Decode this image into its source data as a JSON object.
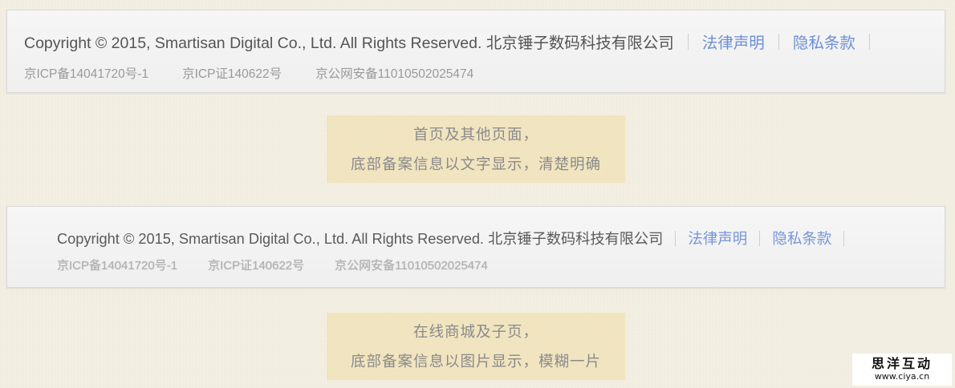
{
  "footer_new": {
    "copyright": "Copyright © 2015, Smartisan Digital Co., Ltd. All Rights Reserved. 北京锤子数码科技有限公司",
    "links": [
      "法律声明",
      "隐私条款"
    ],
    "icp": [
      "京ICP备14041720号-1",
      "京ICP证140622号",
      "京公网安备11010502025474"
    ]
  },
  "caption_1": {
    "line1": "首页及其他页面，",
    "line2": "底部备案信息以文字显示，清楚明确"
  },
  "footer_old": {
    "copyright": "Copyright © 2015, Smartisan Digital Co., Ltd. All Rights Reserved. 北京锤子数码科技有限公司",
    "links": [
      "法律声明",
      "隐私条款"
    ],
    "icp": [
      "京ICP备14041720号-1",
      "京ICP证140622号",
      "京公网安备11010502025474"
    ]
  },
  "caption_2": {
    "line1": "在线商城及子页，",
    "line2": "底部备案信息以图片显示，模糊一片"
  },
  "watermark": {
    "title": "思洋互动",
    "url": "www.ciya.cn"
  },
  "colors": {
    "background": "#f3efe3",
    "link": "#6b8fd6",
    "caption_bg": "#f0e3bd"
  }
}
